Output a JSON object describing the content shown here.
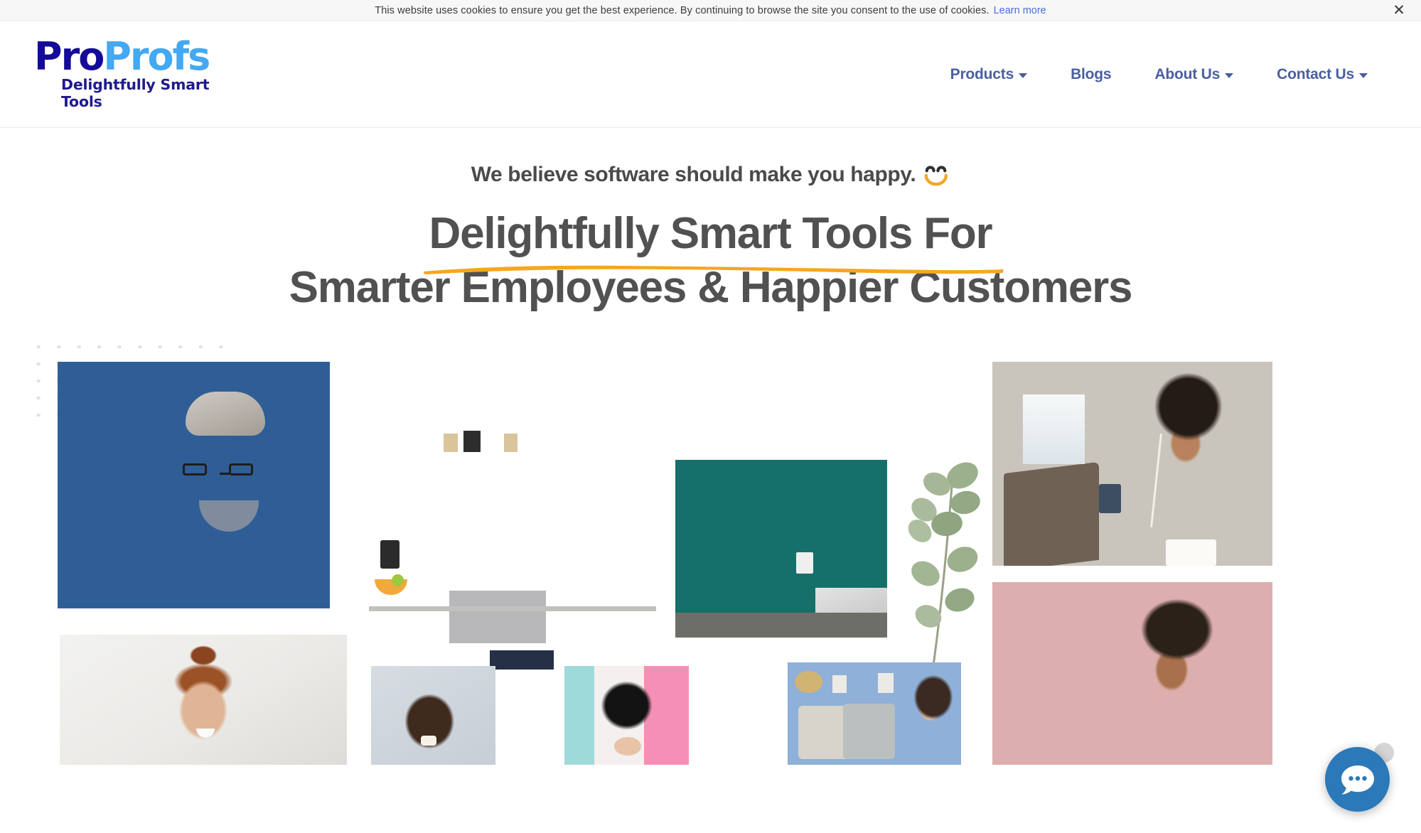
{
  "cookie_bar": {
    "message": "This website uses cookies to ensure you get the best experience. By continuing to browse the site you consent to the use of cookies.",
    "link_label": "Learn more",
    "close_label": "✕",
    "link_color": "#4a6fd4",
    "background": "#f7f7f7"
  },
  "header": {
    "logo": {
      "part_one": "Pro",
      "part_two": "Profs",
      "tagline": "Delightfully Smart Tools",
      "color_part_one": "#140a9a",
      "color_part_two": "#44a8f2",
      "color_tagline": "#1f1a8c"
    },
    "nav": [
      {
        "label": "Products",
        "has_dropdown": true
      },
      {
        "label": "Blogs",
        "has_dropdown": false
      },
      {
        "label": "About Us",
        "has_dropdown": true
      },
      {
        "label": "Contact Us",
        "has_dropdown": true
      }
    ],
    "nav_color": "#4a5fa0"
  },
  "hero": {
    "eyebrow": "We believe software should make you happy.",
    "eyebrow_emoji": "smiley-face",
    "headline_line_1": "Delightfully Smart Tools For",
    "headline_line_2": "Smarter Employees & Happier Customers",
    "headline_color": "#515151",
    "underline_color": "#f5a623"
  },
  "collage": {
    "dot_grid_color": "#e2e2e2",
    "images": [
      {
        "name": "man-glasses-blue-sweater",
        "alt": "Smiling man with glasses in blue sweater at desk"
      },
      {
        "name": "man-laptop-kitchen",
        "alt": "Man working on laptop at kitchen counter"
      },
      {
        "name": "woman-coffee-outdoors",
        "alt": "Woman holding coffee cup outdoors with laptop"
      },
      {
        "name": "eucalyptus-sprig",
        "alt": "Green eucalyptus leaf sprig decoration"
      },
      {
        "name": "woman-headphones-cafe",
        "alt": "Woman with headphones typing on laptop in cafe"
      },
      {
        "name": "woman-curly-hair-smiling",
        "alt": "Smiling woman with curly hair in pink shirt"
      },
      {
        "name": "woman-red-bun-laughing",
        "alt": "Laughing woman with red hair in a bun"
      },
      {
        "name": "man-laughing-portrait",
        "alt": "Laughing man portrait on grey background"
      },
      {
        "name": "woman-colorful-backdrop",
        "alt": "Woman with dark hair on teal and pink backdrop"
      },
      {
        "name": "woman-living-room-denim",
        "alt": "Woman in denim shirt smiling in living room"
      }
    ]
  },
  "chat_widget": {
    "label": "chat-bubble",
    "button_color": "#2b79b8",
    "badge_color": "#d5d5d5"
  }
}
